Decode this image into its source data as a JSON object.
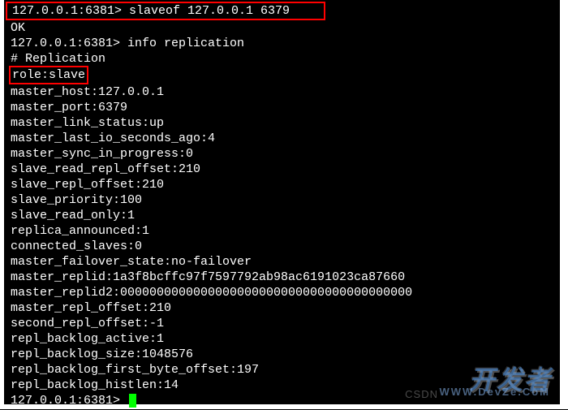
{
  "terminal": {
    "cmd1_prompt": "127.0.0.1:6381> ",
    "cmd1": "slaveof 127.0.0.1 6379",
    "ok": "OK",
    "cmd2_prompt": "127.0.0.1:6381> ",
    "cmd2": "info replication",
    "header": "# Replication",
    "role": "role:slave",
    "lines": [
      "master_host:127.0.0.1",
      "master_port:6379",
      "master_link_status:up",
      "master_last_io_seconds_ago:4",
      "master_sync_in_progress:0",
      "slave_read_repl_offset:210",
      "slave_repl_offset:210",
      "slave_priority:100",
      "slave_read_only:1",
      "replica_announced:1",
      "connected_slaves:0",
      "master_failover_state:no-failover",
      "master_replid:1a3f8bcffc97f7597792ab98ac6191023ca87660",
      "master_replid2:0000000000000000000000000000000000000000",
      "master_repl_offset:210",
      "second_repl_offset:-1",
      "repl_backlog_active:1",
      "repl_backlog_size:1048576",
      "repl_backlog_first_byte_offset:197",
      "repl_backlog_histlen:14"
    ],
    "final_prompt": "127.0.0.1:6381> "
  },
  "watermark": {
    "cn": "开发者",
    "url": "WWW.DevZe.CoM",
    "csdn": "CSDN"
  }
}
